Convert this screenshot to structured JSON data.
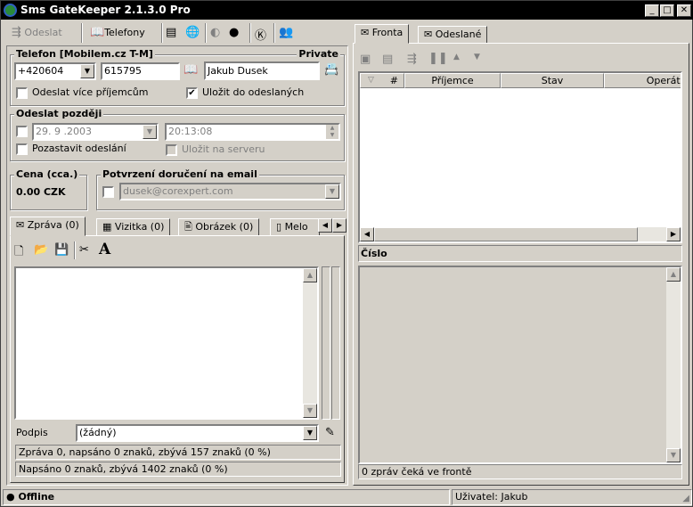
{
  "window": {
    "title": "Sms GateKeeper 2.1.3.0 Pro",
    "minimize": "_",
    "maximize": "□",
    "close": "✕"
  },
  "toolbar": {
    "send_label": "Odeslat",
    "phones_label": "Telefony"
  },
  "phone_group": {
    "title": "Telefon [Mobilem.cz T-M]",
    "private_label": "Private",
    "prefix": "+420604",
    "number": "615795",
    "name": "Jakub Dusek",
    "multi_recipients_label": "Odeslat více příjemcům",
    "multi_recipients_checked": false,
    "save_sent_label": "Uložit do odeslaných",
    "save_sent_checked": true
  },
  "later_group": {
    "title": "Odeslat později",
    "date": "29. 9 .2003",
    "time": "20:13:08",
    "pause_label": "Pozastavit odeslání",
    "save_server_label": "Uložit na serveru"
  },
  "price_group": {
    "title": "Cena (cca.)",
    "value": "0.00 CZK"
  },
  "email_group": {
    "title": "Potvrzení doručení na email",
    "email": "dusek@corexpert.com"
  },
  "message_tabs": [
    {
      "label": "Zpráva (0)"
    },
    {
      "label": "Vizitka (0)"
    },
    {
      "label": "Obrázek (0)"
    },
    {
      "label": "Melo"
    }
  ],
  "signature": {
    "label": "Podpis",
    "value": "(žádný)"
  },
  "message_status": [
    "Zpráva 0, napsáno 0 znaků, zbývá 157 znaků (0 %)",
    "Napsáno 0 znaků, zbývá 1402 znaků (0 %)"
  ],
  "right_tabs": [
    {
      "label": "Fronta"
    },
    {
      "label": "Odeslané"
    }
  ],
  "queue_columns": [
    "#",
    "Příjemce",
    "Stav",
    "Operátor"
  ],
  "detail_header": "Číslo",
  "queue_status": "0 zpráv čeká ve frontě",
  "statusbar": {
    "connection": "Offline",
    "user": "Uživatel: Jakub"
  }
}
